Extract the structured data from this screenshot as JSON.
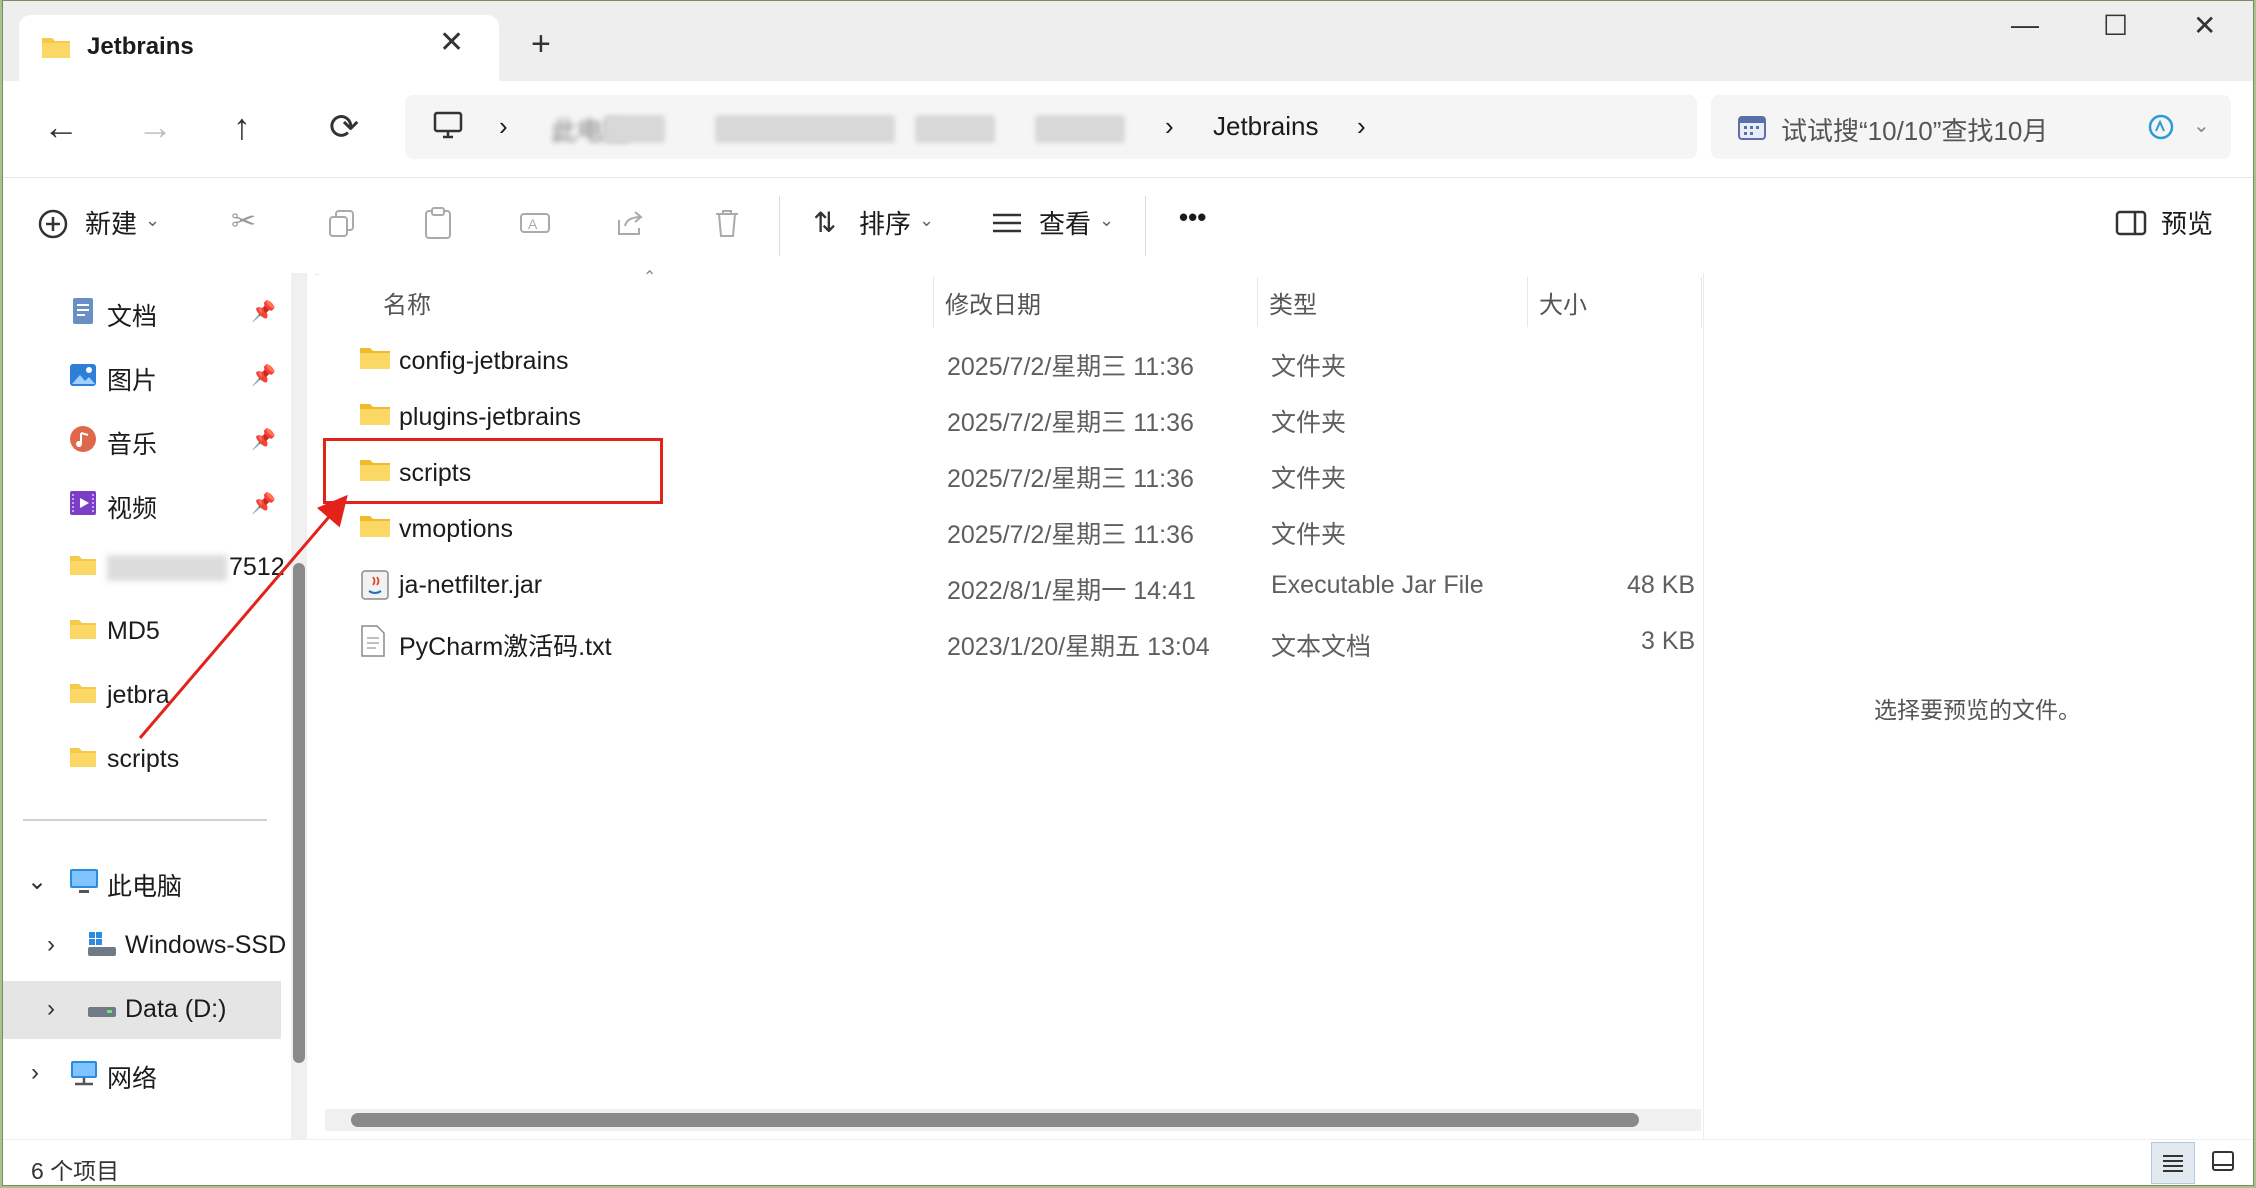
{
  "window": {
    "tab_title": "Jetbrains",
    "close_tab": "✕",
    "new_tab": "+",
    "minimize": "—",
    "maximize": "☐",
    "close": "✕"
  },
  "nav": {
    "back": "←",
    "forward": "→",
    "up": "↑",
    "refresh": "⟳"
  },
  "address": {
    "monitor_icon": "monitor-icon",
    "sep": "›",
    "root": "此电脑",
    "current": "Jetbrains"
  },
  "search": {
    "placeholder": "试试搜“10/10”查找10月"
  },
  "toolbar": {
    "new_label": "新建",
    "sort_label": "排序",
    "view_label": "查看",
    "more_label": "•••",
    "preview_label": "预览"
  },
  "sidebar": {
    "quick": [
      {
        "label": "文档",
        "icon": "document-icon"
      },
      {
        "label": "图片",
        "icon": "picture-icon"
      },
      {
        "label": "音乐",
        "icon": "music-icon"
      },
      {
        "label": "视频",
        "icon": "video-icon"
      },
      {
        "label": "7512",
        "icon": "folder-icon"
      },
      {
        "label": "MD5",
        "icon": "folder-icon"
      },
      {
        "label": "jetbra",
        "icon": "folder-icon"
      },
      {
        "label": "scripts",
        "icon": "folder-icon"
      }
    ],
    "pin": "📌",
    "this_pc": "此电脑",
    "drives": [
      {
        "label": "Windows-SSD"
      },
      {
        "label": "Data (D:)"
      }
    ],
    "network": "网络"
  },
  "columns": {
    "name": "名称",
    "modified": "修改日期",
    "type": "类型",
    "size": "大小"
  },
  "files": [
    {
      "name": "config-jetbrains",
      "modified": "2025/7/2/星期三 11:36",
      "type": "文件夹",
      "size": "",
      "kind": "folder"
    },
    {
      "name": "plugins-jetbrains",
      "modified": "2025/7/2/星期三 11:36",
      "type": "文件夹",
      "size": "",
      "kind": "folder"
    },
    {
      "name": "scripts",
      "modified": "2025/7/2/星期三 11:36",
      "type": "文件夹",
      "size": "",
      "kind": "folder"
    },
    {
      "name": "vmoptions",
      "modified": "2025/7/2/星期三 11:36",
      "type": "文件夹",
      "size": "",
      "kind": "folder"
    },
    {
      "name": "ja-netfilter.jar",
      "modified": "2022/8/1/星期一 14:41",
      "type": "Executable Jar File",
      "size": "48 KB",
      "kind": "jar"
    },
    {
      "name": "PyCharm激活码.txt",
      "modified": "2023/1/20/星期五 13:04",
      "type": "文本文档",
      "size": "3 KB",
      "kind": "txt"
    }
  ],
  "preview": {
    "message": "选择要预览的文件。"
  },
  "status": {
    "count": "6 个项目"
  },
  "colors": {
    "folder": "#f7c948",
    "accent": "#0067c0",
    "annotation": "#e3231b"
  }
}
